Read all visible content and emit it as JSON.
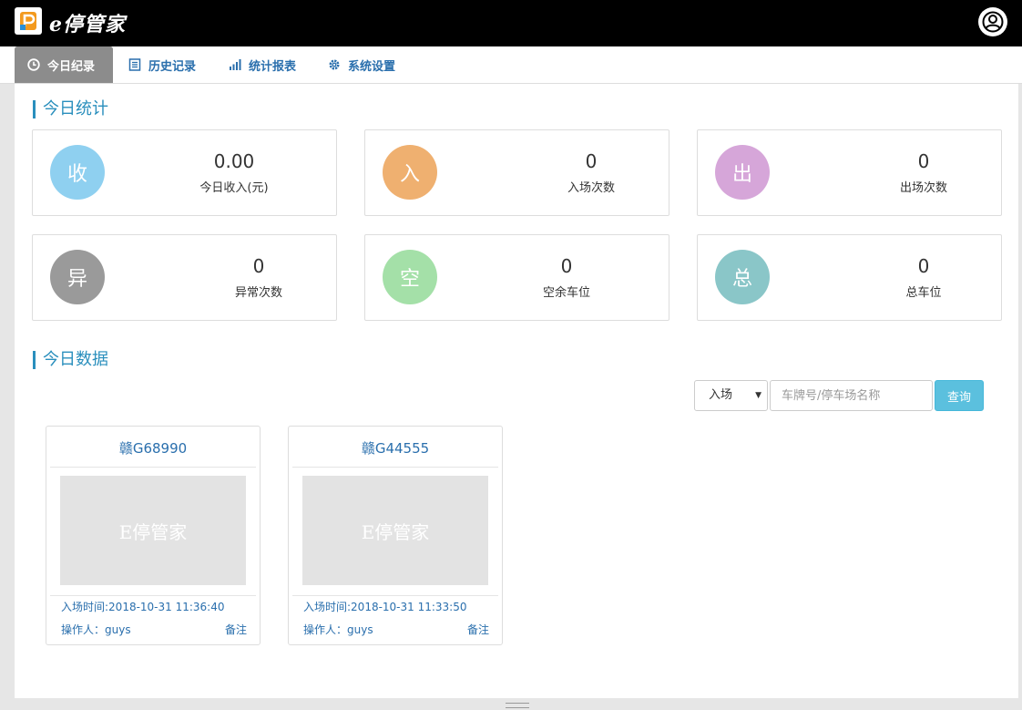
{
  "app": {
    "brand": "e停管家",
    "brand_color": "#000000"
  },
  "nav": {
    "tabs": [
      {
        "label": "今日纪录",
        "icon": "clock-icon",
        "active": true
      },
      {
        "label": "历史记录",
        "icon": "list-icon",
        "active": false
      },
      {
        "label": "统计报表",
        "icon": "bar-chart-icon",
        "active": false
      },
      {
        "label": "系统设置",
        "icon": "gear-icon",
        "active": false
      }
    ]
  },
  "stats": {
    "title": "今日统计",
    "cards": [
      {
        "icon_char": "收",
        "value": "0.00",
        "label": "今日收入(元)",
        "color": "#8fd0f0"
      },
      {
        "icon_char": "入",
        "value": "0",
        "label": "入场次数",
        "color": "#efb070"
      },
      {
        "icon_char": "出",
        "value": "0",
        "label": "出场次数",
        "color": "#d6a6d9"
      },
      {
        "icon_char": "异",
        "value": "0",
        "label": "异常次数",
        "color": "#9a9a9a"
      },
      {
        "icon_char": "空",
        "value": "0",
        "label": "空余车位",
        "color": "#a4e0a8"
      },
      {
        "icon_char": "总",
        "value": "0",
        "label": "总车位",
        "color": "#8ac6c8"
      }
    ]
  },
  "data_section": {
    "title": "今日数据",
    "filter": {
      "selected": "入场",
      "search_placeholder": "车牌号/停车场名称",
      "query_label": "查询"
    },
    "cars": [
      {
        "plate": "赣G68990",
        "image_text": "E停管家",
        "entry_time": "入场时间:2018-10-31 11:36:40",
        "operator": "操作人：guys",
        "note": "备注"
      },
      {
        "plate": "赣G44555",
        "image_text": "E停管家",
        "entry_time": "入场时间:2018-10-31 11:33:50",
        "operator": "操作人：guys",
        "note": "备注"
      }
    ]
  }
}
